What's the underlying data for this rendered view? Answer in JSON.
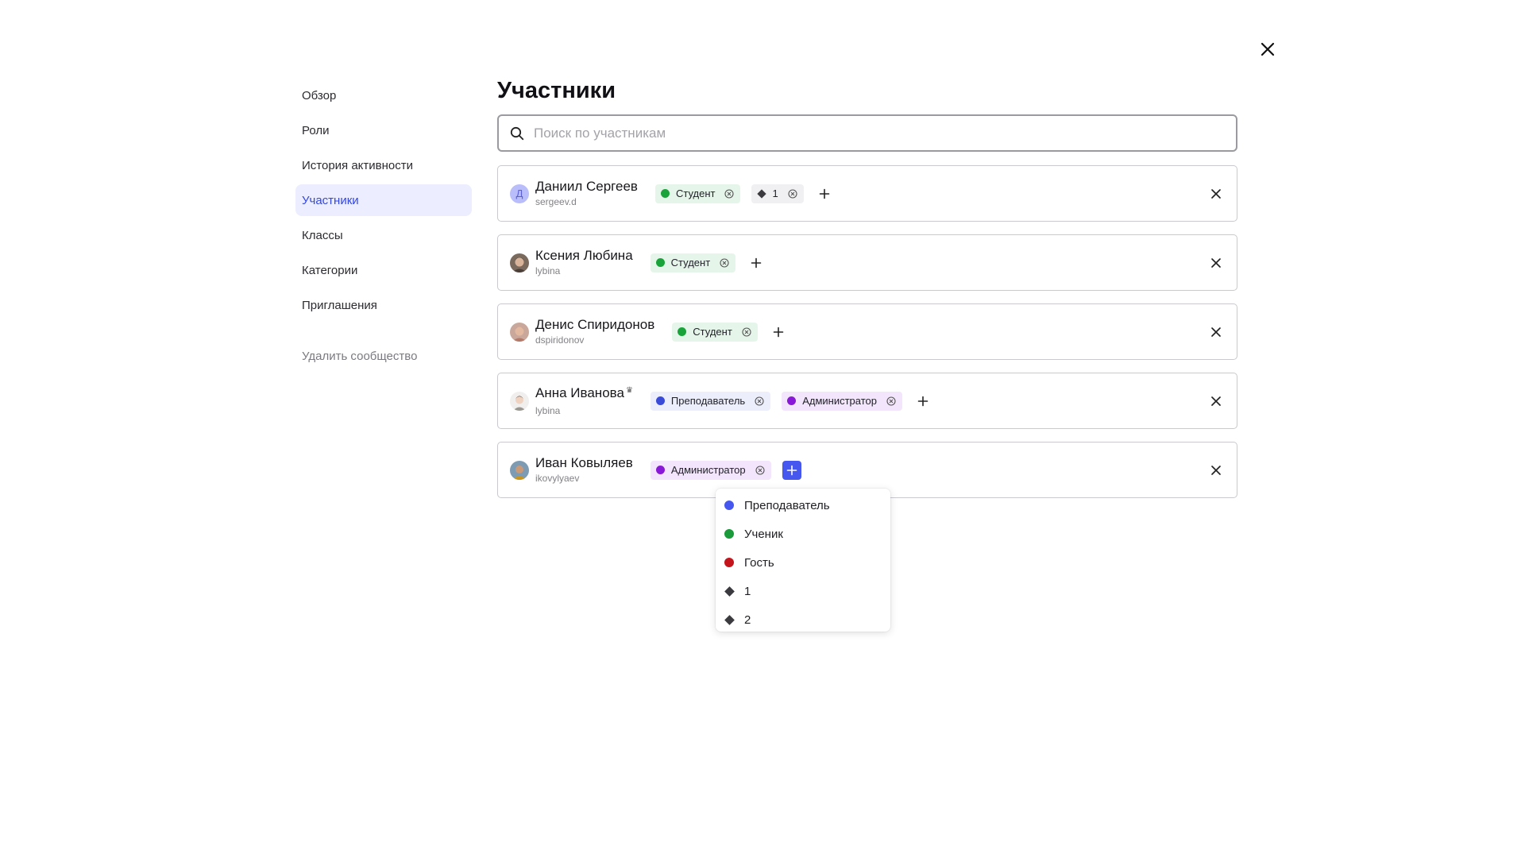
{
  "sidebar": {
    "items": [
      {
        "label": "Обзор"
      },
      {
        "label": "Роли"
      },
      {
        "label": "История активности"
      },
      {
        "label": "Участники"
      },
      {
        "label": "Классы"
      },
      {
        "label": "Категории"
      },
      {
        "label": "Приглашения"
      }
    ],
    "active": "Участники",
    "danger_label": "Удалить сообщество"
  },
  "main": {
    "title": "Участники",
    "search": {
      "placeholder": "Поиск по участникам",
      "value": ""
    },
    "members": [
      {
        "name": "Даниил Сергеев",
        "login": "sergeev.d",
        "avatar_letter": "Д",
        "tags": [
          {
            "label": "Студент",
            "color": "#1aa33a",
            "shape": "dot"
          },
          {
            "label": "1",
            "color": "#3a3a3f",
            "shape": "diamond"
          }
        ]
      },
      {
        "name": "Ксения Любина",
        "login": "lybina",
        "tags": [
          {
            "label": "Студент",
            "color": "#1aa33a",
            "shape": "dot"
          }
        ]
      },
      {
        "name": "Денис Спиридонов",
        "login": "dspiridonov",
        "tags": [
          {
            "label": "Студент",
            "color": "#1aa33a",
            "shape": "dot"
          }
        ]
      },
      {
        "name": "Анна Иванова",
        "owner_badge": "♛",
        "login": "lybina",
        "tags": [
          {
            "label": "Преподаватель",
            "color": "#3a4bd8",
            "shape": "dot"
          },
          {
            "label": "Администратор",
            "color": "#8a18d8",
            "shape": "dot"
          }
        ]
      },
      {
        "name": "Иван Ковыляев",
        "login": "ikovylyaev",
        "tags": [
          {
            "label": "Администратор",
            "color": "#8a18d8",
            "shape": "dot"
          }
        ]
      }
    ]
  },
  "role_dropdown": {
    "items": [
      {
        "label": "Преподаватель",
        "color": "#4657f0",
        "shape": "dot"
      },
      {
        "label": "Ученик",
        "color": "#1a9a3a",
        "shape": "dot"
      },
      {
        "label": "Гость",
        "color": "#c4141c",
        "shape": "dot"
      },
      {
        "label": "1",
        "color": "#3a3a3f",
        "shape": "diamond"
      },
      {
        "label": "2",
        "color": "#3a3a3f",
        "shape": "diamond"
      }
    ]
  },
  "icons": {
    "close": "close-icon",
    "search": "search-icon",
    "remove_tag": "remove-tag-icon",
    "add": "plus-icon",
    "remove_member": "close-icon"
  },
  "colors": {
    "accent": "#4657f0",
    "active_nav_bg": "#eceeff",
    "active_nav_text": "#3346e0"
  }
}
